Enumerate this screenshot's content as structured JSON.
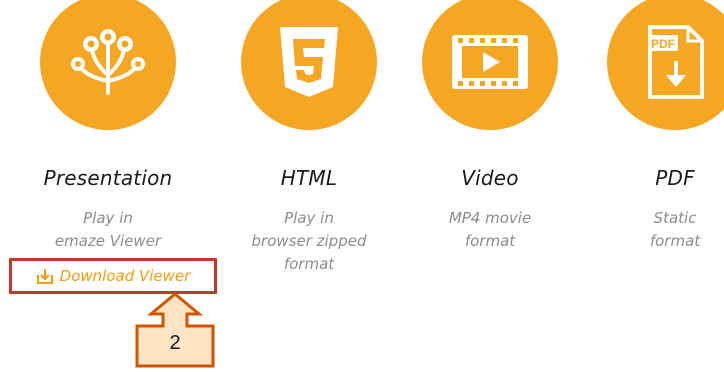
{
  "formats": [
    {
      "title": "Presentation",
      "desc": [
        "Play in",
        "emaze Viewer"
      ],
      "icon": "peacock-icon"
    },
    {
      "title": "HTML",
      "desc": [
        "Play in",
        "browser zipped",
        "format"
      ],
      "icon": "html5-icon"
    },
    {
      "title": "Video",
      "desc": [
        "MP4 movie",
        "format"
      ],
      "icon": "video-play-icon"
    },
    {
      "title": "PDF",
      "desc": [
        "Static",
        "format"
      ],
      "icon": "pdf-download-icon"
    }
  ],
  "download_viewer": {
    "label": "Download Viewer",
    "icon": "download-icon"
  },
  "callout": {
    "number": "2"
  },
  "colors": {
    "accent": "#f5a623",
    "link": "#f39c12",
    "highlight": "#c0392b",
    "callout_fill": "#fce4c4"
  }
}
